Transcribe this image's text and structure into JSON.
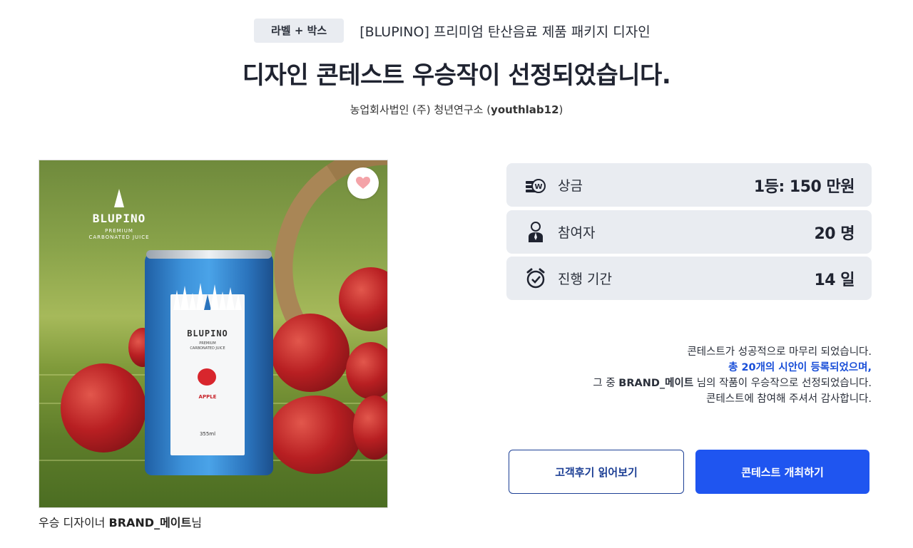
{
  "header": {
    "category_tag": "라벨 + 박스",
    "contest_title": "[BLUPINO] 프리미엄 탄산음료 제품 패키지 디자인",
    "main_title": "디자인 콘테스트 우승작이 선정되었습니다.",
    "client_name": "농업회사법인 (주) 청년연구소 (",
    "client_id": "youthlab12",
    "client_close": ")"
  },
  "winner_image": {
    "brand": "BLUPINO",
    "brand_sub": "PREMIUM\nCARBONATED JUICE",
    "can_brand": "BLUPINO",
    "can_sub": "PREMIUM\nCARBONATED JUICE",
    "can_flavor": "APPLE",
    "can_volume": "355ml",
    "like_icon": "heart-icon"
  },
  "caption": {
    "prefix": "우승 디자이너 ",
    "designer": "BRAND_메이트",
    "suffix": "님"
  },
  "stats": [
    {
      "icon": "prize-money-icon",
      "label": "상금",
      "value": "1등: 150 만원"
    },
    {
      "icon": "participant-icon",
      "label": "참여자",
      "value": "20 명"
    },
    {
      "icon": "alarm-clock-icon",
      "label": "진행 기간",
      "value": "14 일"
    }
  ],
  "message": {
    "line1": "콘테스트가 성공적으로 마무리 되었습니다.",
    "line2": "총 20개의 시안이 등록되었으며,",
    "line3_prefix": "그 중 ",
    "line3_designer": "BRAND_메이트",
    "line3_suffix": " 님의 작품이 우승작으로 선정되었습니다.",
    "line4": "콘테스트에 참여해 주셔서 감사합니다."
  },
  "buttons": {
    "reviews": "고객후기 읽어보기",
    "host_contest": "콘테스트 개최하기"
  },
  "colors": {
    "accent_blue": "#1f55f0",
    "highlight_text": "#1a4fd8",
    "stat_bg": "#e9ecf1",
    "outline_button": "#1c3f95"
  }
}
